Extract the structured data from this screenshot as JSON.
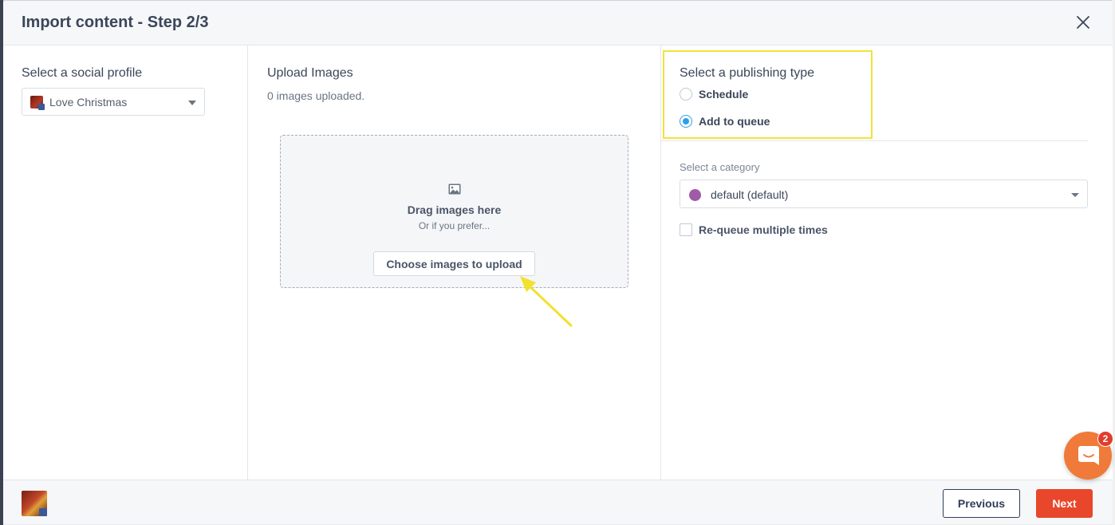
{
  "modal": {
    "title": "Import content - Step 2/3"
  },
  "left": {
    "label": "Select a social profile",
    "profile": {
      "name": "Love Christmas",
      "network_icon": "facebook-icon"
    }
  },
  "middle": {
    "label": "Upload Images",
    "count_text": "0 images uploaded.",
    "dropzone": {
      "icon": "image-icon",
      "title": "Drag images here",
      "subtitle": "Or if you prefer...",
      "button": "Choose images to upload"
    }
  },
  "right": {
    "publishing_type": {
      "label": "Select a publishing type",
      "options": [
        {
          "label": "Schedule",
          "selected": false
        },
        {
          "label": "Add to queue",
          "selected": true
        }
      ]
    },
    "category": {
      "label": "Select a category",
      "value": "default  (default)",
      "color": "#a05ba8"
    },
    "requeue": {
      "label": "Re-queue multiple times",
      "checked": false
    }
  },
  "footer": {
    "previous": "Previous",
    "next": "Next"
  },
  "chat": {
    "badge": "2"
  },
  "colors": {
    "accent_primary": "#e8472b",
    "radio_selected": "#2e9fe6",
    "highlight": "#f5e13b",
    "annotation_arrow": "#f2e12e"
  }
}
